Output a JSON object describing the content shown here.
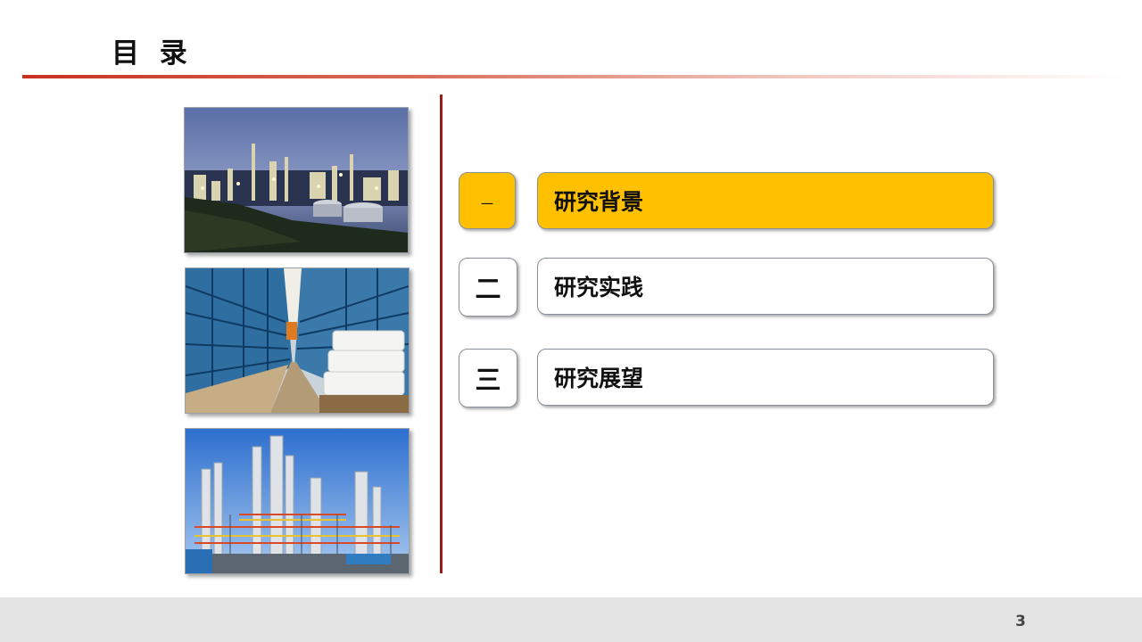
{
  "slide": {
    "title": "目 录",
    "page_number": "3"
  },
  "photos": [
    {
      "icon": "refinery-night-photo"
    },
    {
      "icon": "warehouse-racks-photo"
    },
    {
      "icon": "chemical-plant-towers-photo"
    }
  ],
  "toc": {
    "items": [
      {
        "num": "一",
        "label": "研究背景",
        "active": true
      },
      {
        "num": "二",
        "label": "研究实践",
        "active": false
      },
      {
        "num": "三",
        "label": "研究展望",
        "active": false
      }
    ]
  },
  "colors": {
    "accent": "#ffc000",
    "divider": "#9b1c1c",
    "title_rule": "#c8321e",
    "footer": "#e4e4e4"
  }
}
